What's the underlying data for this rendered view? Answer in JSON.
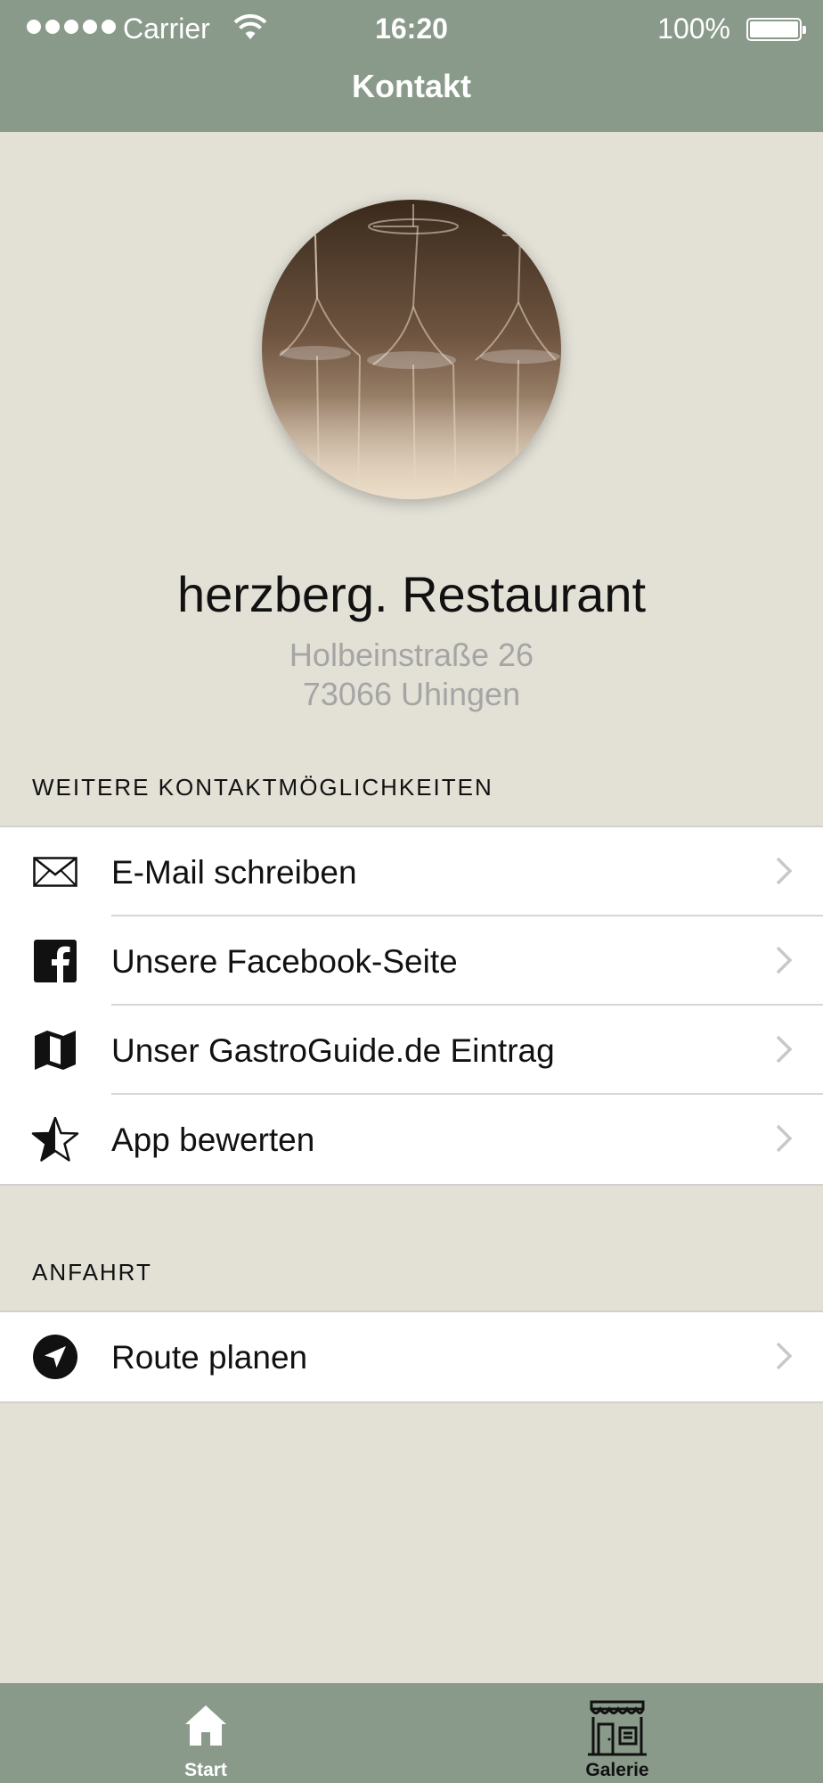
{
  "status_bar": {
    "carrier": "Carrier",
    "time": "16:20",
    "battery": "100%",
    "battery_level": 1.0,
    "signal_bars": 5
  },
  "nav": {
    "title": "Kontakt"
  },
  "profile": {
    "name": "herzberg. Restaurant",
    "address_line1": "Holbeinstraße 26",
    "address_line2": "73066 Uhingen"
  },
  "contact_section": {
    "header": "WEITERE KONTAKTMÖGLICHKEITEN",
    "items": [
      {
        "label": "E-Mail schreiben",
        "icon": "envelope-icon"
      },
      {
        "label": "Unsere Facebook-Seite",
        "icon": "facebook-icon"
      },
      {
        "label": "Unser GastroGuide.de Eintrag",
        "icon": "map-icon"
      },
      {
        "label": "App bewerten",
        "icon": "star-icon"
      }
    ]
  },
  "route_section": {
    "header": "ANFAHRT",
    "items": [
      {
        "label": "Route planen",
        "icon": "location-arrow-icon"
      }
    ]
  },
  "tab_bar": {
    "tabs": [
      {
        "label": "Start",
        "icon": "home-icon"
      },
      {
        "label": "Galerie",
        "icon": "storefront-icon"
      }
    ]
  },
  "colors": {
    "bar": "#8a9a8a",
    "background": "#e3e1d6",
    "address_gray": "#a5a5a5",
    "chevron": "#c7c7cc"
  }
}
